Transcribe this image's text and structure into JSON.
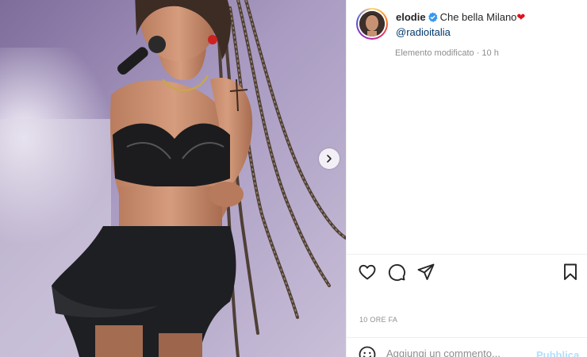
{
  "post": {
    "username": "elodie",
    "caption_text": "Che bella Milano",
    "caption_emoji": "❤",
    "mention": "@radioitalia",
    "edited_label": "Elemento modificato · 10 h",
    "timestamp": "10 ORE FA"
  },
  "comment": {
    "placeholder": "Aggiungi un commento...",
    "publish_label": "Pubblica"
  },
  "icons": {
    "carousel_next": "chevron-right-icon",
    "verified": "verified-badge-icon",
    "like": "heart-icon",
    "comment": "speech-bubble-icon",
    "share": "paper-plane-icon",
    "save": "bookmark-icon",
    "emoji": "smiley-icon"
  },
  "colors": {
    "verified_blue": "#3897f0",
    "link": "#00376b",
    "muted": "#8e8e8e",
    "publish_disabled": "#b2dffc",
    "text": "#262626"
  }
}
